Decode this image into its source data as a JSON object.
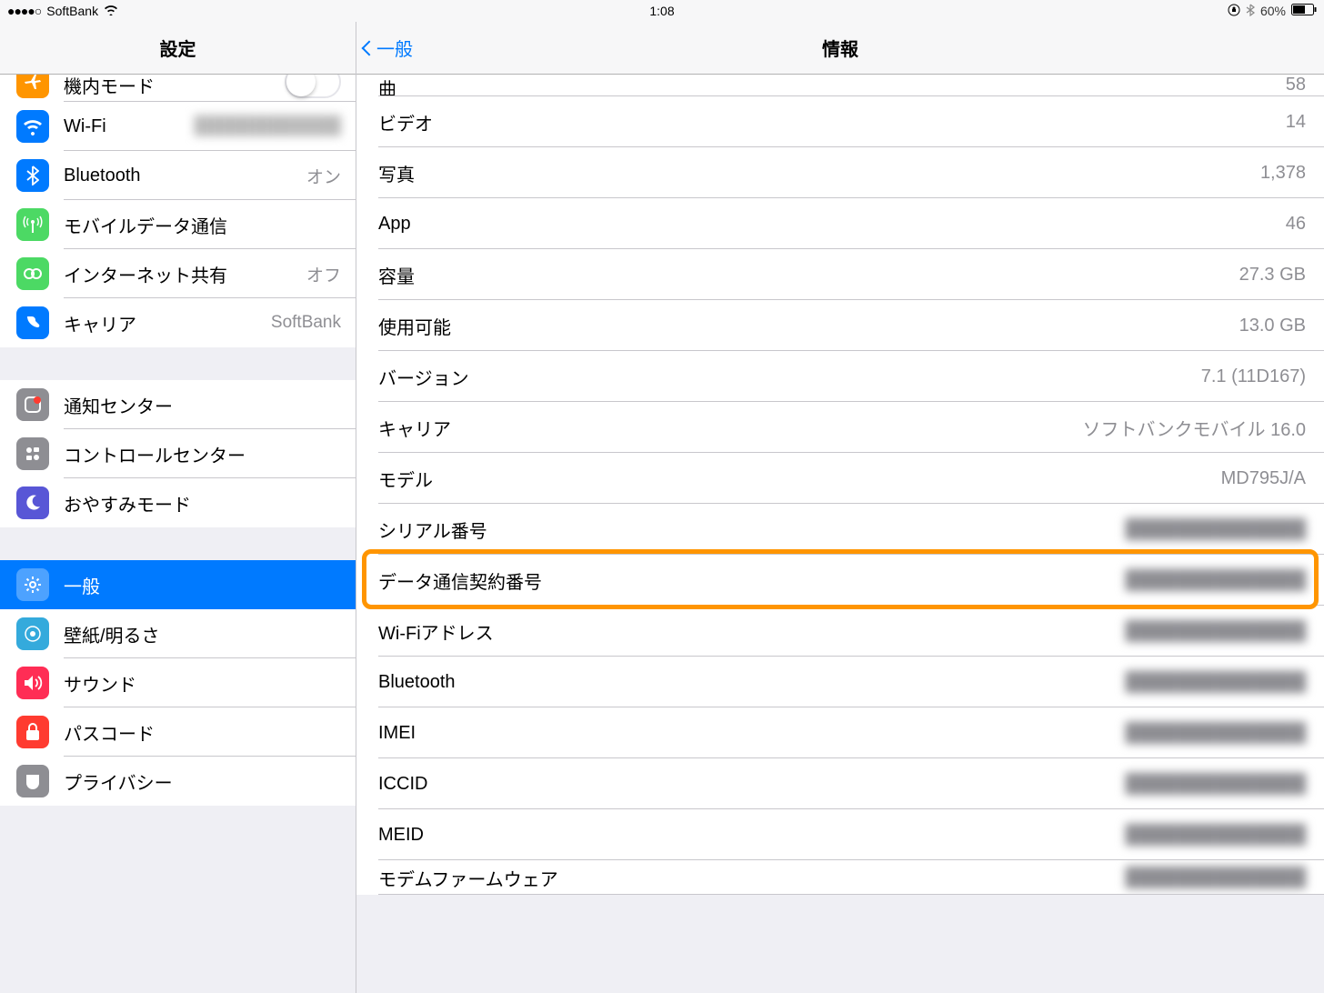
{
  "status": {
    "signal": "●●●●○",
    "carrier": "SoftBank",
    "time": "1:08",
    "battery_pct": "60%"
  },
  "sidebar": {
    "title": "設定",
    "group1": [
      {
        "name": "airplane",
        "label": "機内モード",
        "icon_bg": "ic-orange",
        "glyph": "✈",
        "toggle": true
      },
      {
        "name": "wifi",
        "label": "Wi-Fi",
        "icon_bg": "ic-blue",
        "glyph": "",
        "value_blur": true
      },
      {
        "name": "bluetooth",
        "label": "Bluetooth",
        "icon_bg": "ic-blue",
        "glyph": "",
        "value": "オン"
      },
      {
        "name": "cellular",
        "label": "モバイルデータ通信",
        "icon_bg": "ic-green",
        "glyph": ""
      },
      {
        "name": "hotspot",
        "label": "インターネット共有",
        "icon_bg": "ic-green",
        "glyph": "",
        "value": "オフ"
      },
      {
        "name": "carrier",
        "label": "キャリア",
        "icon_bg": "ic-blue",
        "glyph": "",
        "value": "SoftBank"
      }
    ],
    "group2": [
      {
        "name": "notification",
        "label": "通知センター",
        "icon_bg": "ic-gray",
        "glyph": ""
      },
      {
        "name": "controlcenter",
        "label": "コントロールセンター",
        "icon_bg": "ic-gray",
        "glyph": ""
      },
      {
        "name": "dnd",
        "label": "おやすみモード",
        "icon_bg": "ic-purple",
        "glyph": ""
      }
    ],
    "group3": [
      {
        "name": "general",
        "label": "一般",
        "icon_bg": "ic-gray",
        "glyph": "",
        "selected": true
      },
      {
        "name": "wallpaper",
        "label": "壁紙/明るさ",
        "icon_bg": "ic-teal",
        "glyph": ""
      },
      {
        "name": "sounds",
        "label": "サウンド",
        "icon_bg": "ic-pink",
        "glyph": ""
      },
      {
        "name": "passcode",
        "label": "パスコード",
        "icon_bg": "ic-red",
        "glyph": ""
      },
      {
        "name": "privacy",
        "label": "プライバシー",
        "icon_bg": "ic-gray",
        "glyph": ""
      }
    ]
  },
  "detail": {
    "back_label": "一般",
    "title": "情報",
    "rows": [
      {
        "name": "songs",
        "label": "曲",
        "value": "58",
        "partial": "top"
      },
      {
        "name": "videos",
        "label": "ビデオ",
        "value": "14"
      },
      {
        "name": "photos",
        "label": "写真",
        "value": "1,378"
      },
      {
        "name": "apps",
        "label": "App",
        "value": "46"
      },
      {
        "name": "capacity",
        "label": "容量",
        "value": "27.3 GB"
      },
      {
        "name": "available",
        "label": "使用可能",
        "value": "13.0 GB"
      },
      {
        "name": "version",
        "label": "バージョン",
        "value": "7.1 (11D167)"
      },
      {
        "name": "carrier",
        "label": "キャリア",
        "value": "ソフトバンクモバイル 16.0"
      },
      {
        "name": "model",
        "label": "モデル",
        "value": "MD795J/A"
      },
      {
        "name": "serial",
        "label": "シリアル番号",
        "value_blur": true
      },
      {
        "name": "data-contract",
        "label": "データ通信契約番号",
        "value_blur": true,
        "highlight": true
      },
      {
        "name": "wifi-address",
        "label": "Wi-Fiアドレス",
        "value_blur": true
      },
      {
        "name": "bluetooth-addr",
        "label": "Bluetooth",
        "value_blur": true
      },
      {
        "name": "imei",
        "label": "IMEI",
        "value_blur": true
      },
      {
        "name": "iccid",
        "label": "ICCID",
        "value_blur": true
      },
      {
        "name": "meid",
        "label": "MEID",
        "value_blur": true
      },
      {
        "name": "firmware",
        "label": "モデムファームウェア",
        "value_blur": true,
        "partial": "bottom"
      }
    ]
  }
}
